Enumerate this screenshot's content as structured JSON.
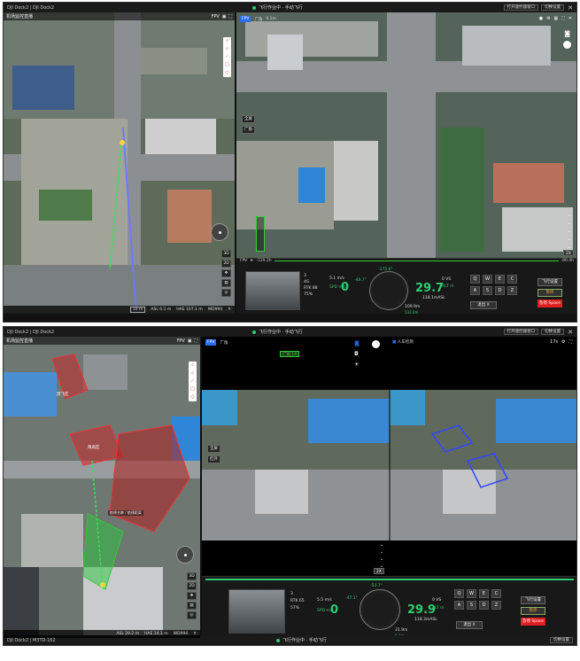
{
  "colors": {
    "accent": "#2ecc71",
    "danger": "#e02020",
    "brand": "#2b6df0"
  },
  "win1": {
    "title": "DJI Dock2 | DJI Dock2",
    "status": "飞行作业中 · 手动飞行",
    "btn_return": "打开遥控器窗口",
    "btn_exit": "切换设置",
    "map": {
      "title": "机场监控直播",
      "fpv": "FPV",
      "scale": "10 m",
      "asl": "ASL 0.1 m",
      "hae": "HAE 107.1 m",
      "net": "WD994"
    },
    "map_btns": [
      "3D",
      "2D"
    ],
    "video": {
      "tabs": [
        "FPV",
        "广角"
      ],
      "sub": "0.1m",
      "zoom": "2X",
      "left_btns": [
        "全屏",
        "广角"
      ],
      "fpv_label": "FPV"
    },
    "timeline": {
      "start": "-119.2h",
      "end": "-80.4h"
    },
    "tele": {
      "wind": "3",
      "sig1": "4G",
      "rtk": "RTK 88",
      "batt": "75%",
      "spd_label": "SPD m/s",
      "spd": "0",
      "hs": "5.1 m/s",
      "vs": "0 VS",
      "alt_label": "ALT m",
      "alt": "29.7",
      "asl": "118.1mASL",
      "dist1": "109.9m",
      "dist2": "533.0m",
      "heading": "-175.6°",
      "pitch": "-48.7°"
    },
    "keys": {
      "top": [
        "Q",
        "W",
        "E",
        "C"
      ],
      "bot": [
        "A",
        "S",
        "D",
        "Z"
      ],
      "exit": "退出 X"
    },
    "actions": {
      "fly": "飞行设置",
      "pause": "暂停",
      "stop": "急停 Space"
    }
  },
  "win2": {
    "title": "DJI Dock2 | DJI Dock2",
    "footer_title": "DJI Dock2 | M3TD-152",
    "status": "飞行作业中 · 手动飞行",
    "btn_return": "打开遥控器窗口",
    "btn_exit": "切换设置",
    "map": {
      "title": "机场监控直播",
      "fpv": "FPV",
      "asl": "ASL 29.2 m",
      "hae": "HAE 14.1 m",
      "net": "WD994",
      "zone1": "禁飞区",
      "zone2": "限高区",
      "zone3": "航线区",
      "route": "航线名称 / 航线距离"
    },
    "map_btns": [
      "3D",
      "2D"
    ],
    "video": {
      "tabs": [
        "FPV",
        "广角"
      ],
      "badge": "广角 1X",
      "mode": "人车检测",
      "zoom": "2X",
      "left_btns": [
        "全屏",
        "红外"
      ],
      "rec": "17s"
    },
    "tele": {
      "wind": "3",
      "rtk": "RTK 65",
      "batt": "57%",
      "spd_label": "SPD m/s",
      "spd": "0",
      "hs": "5.5 m/s",
      "vs": "0 VS",
      "alt_label": "ALT m",
      "alt": "29.9",
      "asl": "118.3mASL",
      "dist1": "31.9m",
      "dist2": "0.3m",
      "heading": "-53.7°",
      "pitch": "-47.1°"
    },
    "keys": {
      "top": [
        "Q",
        "W",
        "E",
        "C"
      ],
      "bot": [
        "A",
        "S",
        "D",
        "Z"
      ],
      "exit": "退出 X"
    },
    "actions": {
      "fly": "飞行设置",
      "pause": "暂停",
      "stop": "急停 Space"
    }
  }
}
